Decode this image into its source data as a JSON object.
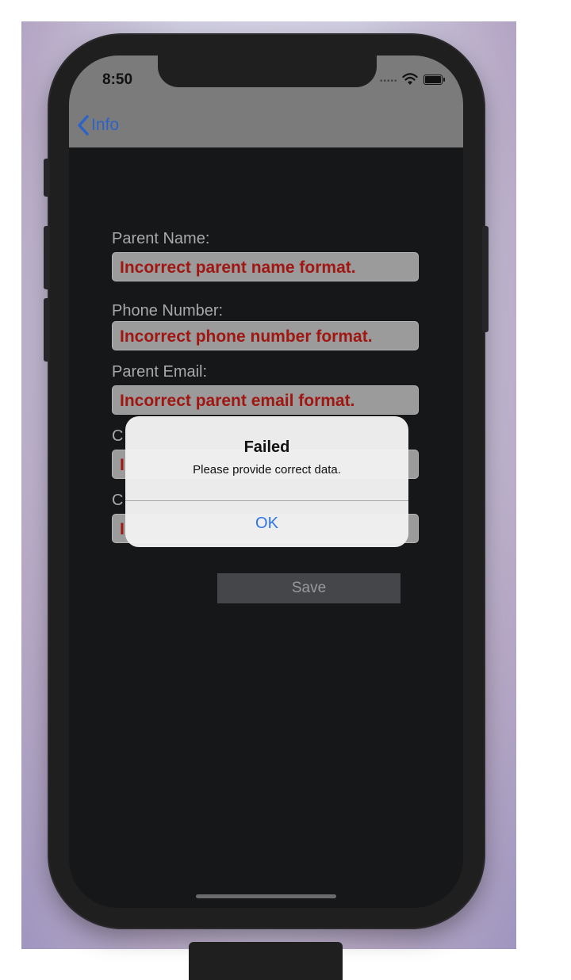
{
  "status_bar": {
    "time": "8:50"
  },
  "nav": {
    "back_label": "Info"
  },
  "form": {
    "fields": [
      {
        "label": "Parent Name:",
        "value": "Incorrect parent name format."
      },
      {
        "label": "Phone Number:",
        "value": "Incorrect phone number format."
      },
      {
        "label": "Parent Email:",
        "value": "Incorrect parent email format."
      },
      {
        "label": "C",
        "value": "I"
      },
      {
        "label": "C",
        "value": "I"
      }
    ],
    "save_label": "Save"
  },
  "alert": {
    "title": "Failed",
    "message": "Please provide correct data.",
    "ok_label": "OK"
  },
  "colors": {
    "nav_background": "#7b7b7c",
    "error_text": "#a01712",
    "ios_blue": "#2f74e8",
    "screen_background": "#161719"
  }
}
